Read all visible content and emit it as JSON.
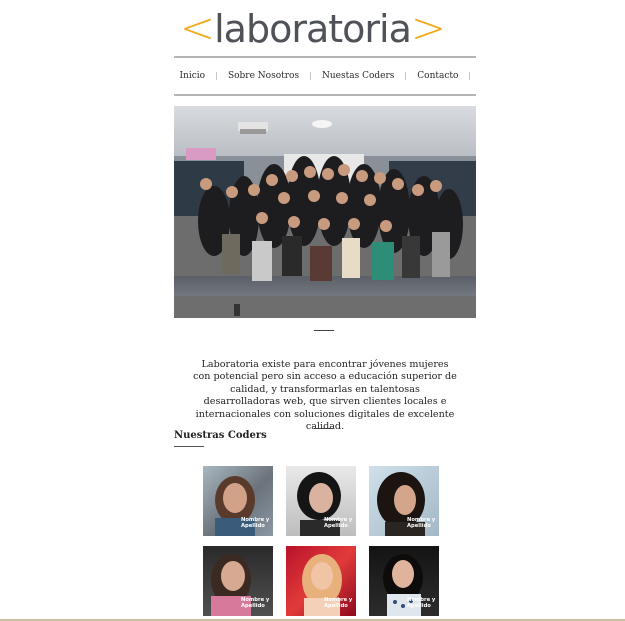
{
  "logo": {
    "open": "<",
    "text": "laboratoria",
    "close": ">"
  },
  "nav": {
    "items": [
      "Inicio",
      "Sobre Nosotros",
      "Nuestas Coders",
      "Contacto"
    ]
  },
  "hero": {
    "alt": "Group photo of Laboratoria students in a classroom"
  },
  "about": {
    "text": "Laboratoria existe para encontrar jóvenes mujeres con potencial pero sin acceso a educación superior de calidad, y transformarlas en talentosas desarrolladoras web, que sirven clientes locales e internacionales con soluciones digitales de excelente calidad."
  },
  "coders": {
    "title": "Nuestras Coders",
    "cards": [
      {
        "line1": "Nombre y",
        "line2": "Apellido"
      },
      {
        "line1": "Nombre y",
        "line2": "Apellido"
      },
      {
        "line1": "Nombre y",
        "line2": "Apellido"
      },
      {
        "line1": "Nombre y",
        "line2": "Apellido"
      },
      {
        "line1": "Nombre y",
        "line2": "Apellido"
      },
      {
        "line1": "Nombre y",
        "line2": "Apellido"
      }
    ]
  },
  "colors": {
    "accent": "#f0a91b",
    "logo_text": "#4f5257",
    "rule": "#b3b3b3"
  }
}
